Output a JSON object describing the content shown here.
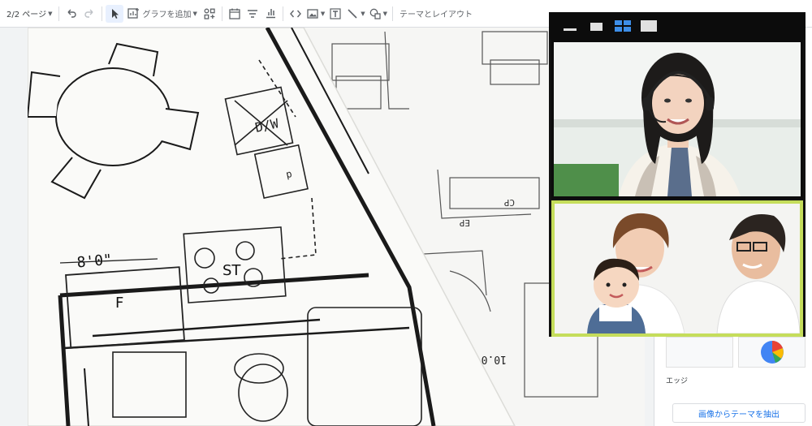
{
  "toolbar": {
    "page_indicator": "2/2 ページ",
    "add_chart_label": "グラフを追加",
    "theme_layout_label": "テーマとレイアウト"
  },
  "panel": {
    "edge_label": "エッジ",
    "extract_button": "画像からテーマを抽出"
  },
  "floorplan": {
    "dimension": "8'0\"",
    "dw_label": "D/W",
    "f_label": "F",
    "st_label": "ST",
    "cp_label": "CP",
    "ep_label": "EP",
    "p_label": "p",
    "code_label": "10.0"
  },
  "video_call": {
    "layout_buttons": [
      "minimize-layout",
      "single-layout",
      "grid-layout",
      "full-layout"
    ],
    "accent": "#c5dd5b",
    "active_layout": "#3d8ee8"
  },
  "colors": {
    "toolbar_bg": "#ffffff",
    "accent_blue": "#1a73e8"
  }
}
